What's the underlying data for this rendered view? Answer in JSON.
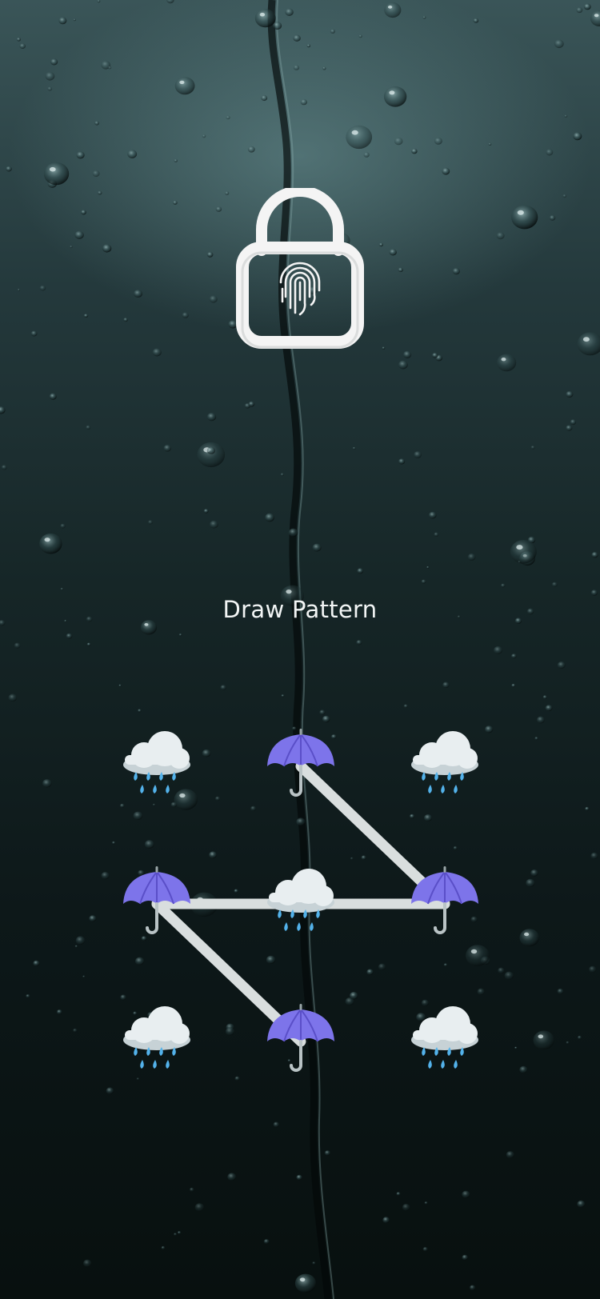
{
  "background": {
    "type": "rain-on-glass",
    "colors": [
      "#3a5558",
      "#162627",
      "#08100f"
    ]
  },
  "lock": {
    "icon": "padlock-open-fingerprint-icon",
    "color": "#f4f4f4"
  },
  "prompt": {
    "title": "Draw Pattern"
  },
  "pattern": {
    "rows": 3,
    "cols": 3,
    "dots": [
      {
        "icon": "rain-cloud-icon",
        "selected": false
      },
      {
        "icon": "umbrella-icon",
        "selected": true
      },
      {
        "icon": "rain-cloud-icon",
        "selected": false
      },
      {
        "icon": "umbrella-icon",
        "selected": true
      },
      {
        "icon": "rain-cloud-icon",
        "selected": false
      },
      {
        "icon": "umbrella-icon",
        "selected": true
      },
      {
        "icon": "rain-cloud-icon",
        "selected": false
      },
      {
        "icon": "umbrella-icon",
        "selected": true
      },
      {
        "icon": "rain-cloud-icon",
        "selected": false
      }
    ],
    "path": [
      1,
      5,
      3,
      7
    ],
    "line_color": "#d9dede",
    "umbrella_color": "#7d74ea",
    "cloud_color": "#e8eef0",
    "rain_color": "#53b2ea"
  }
}
